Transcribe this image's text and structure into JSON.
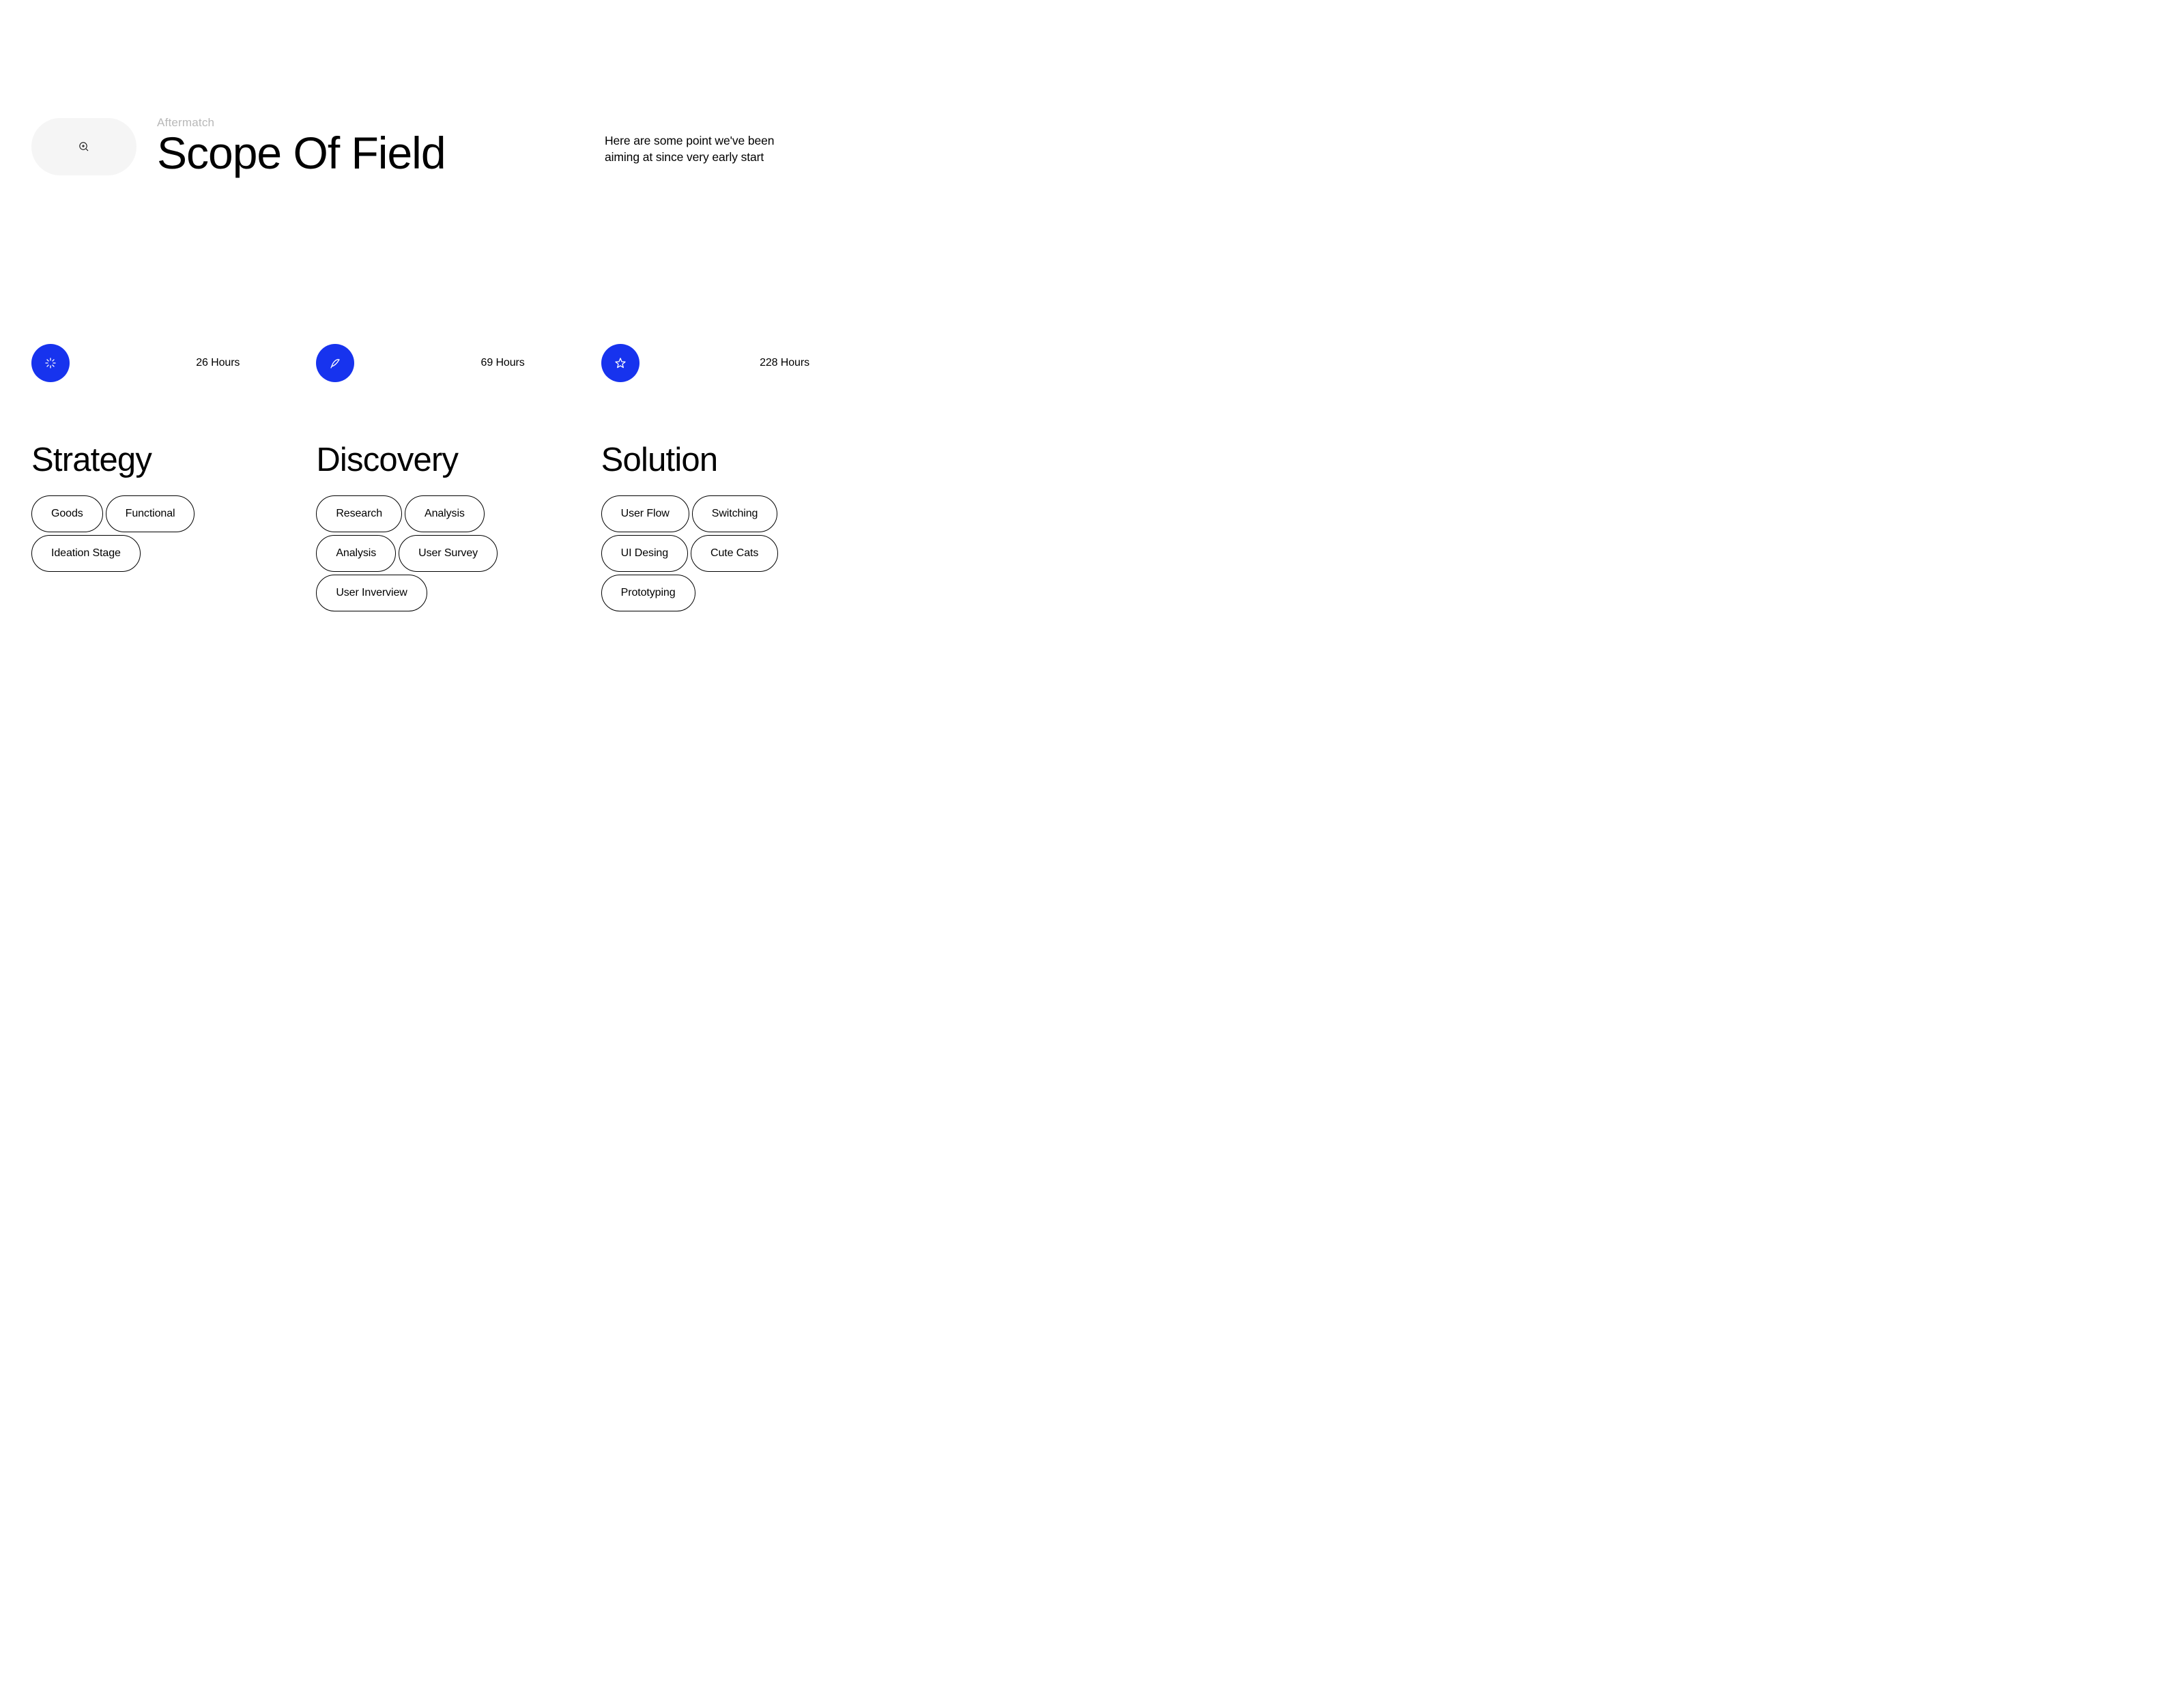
{
  "header": {
    "eyebrow": "Aftermatch",
    "title": "Scope Of Field",
    "subtitle": "Here are some point we've been aiming at since very early start"
  },
  "cards": [
    {
      "icon": "sparkle",
      "hours": "26 Hours",
      "title": "Strategy",
      "tags": [
        "Goods",
        "Functional",
        "Ideation Stage"
      ]
    },
    {
      "icon": "feather",
      "hours": "69 Hours",
      "title": "Discovery",
      "tags": [
        "Research",
        "Analysis",
        "Analysis",
        "User Survey",
        "User Inverview"
      ]
    },
    {
      "icon": "star",
      "hours": "228 Hours",
      "title": "Solution",
      "tags": [
        "User Flow",
        "Switching",
        "UI Desing",
        "Cute Cats",
        "Prototyping"
      ]
    }
  ],
  "colors": {
    "accent": "#1733ee",
    "pill_bg": "#f5f5f5",
    "eyebrow": "#b8b8b8"
  }
}
